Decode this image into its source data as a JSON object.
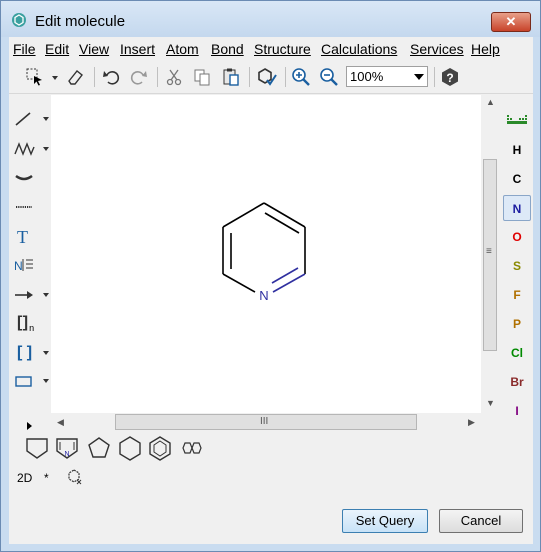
{
  "window": {
    "title": "Edit molecule",
    "close_label": "✕"
  },
  "menu": [
    "File",
    "Edit",
    "View",
    "Insert",
    "Atom",
    "Bond",
    "Structure",
    "Calculations",
    "Services",
    "Help"
  ],
  "toolbar": {
    "zoom_value": "100%"
  },
  "left_tools": {
    "text_tool": "T",
    "bracket_n": "[ ]",
    "bracket_n_sub": "n",
    "bracket": "[ ]"
  },
  "atoms": [
    "H",
    "C",
    "N",
    "O",
    "S",
    "F",
    "P",
    "Cl",
    "Br",
    "I"
  ],
  "atom_colors": [
    "#000000",
    "#000000",
    "#1c1ca0",
    "#e00000",
    "#8a8a00",
    "#b07000",
    "#b07000",
    "#008a00",
    "#8a2a2a",
    "#800080"
  ],
  "selected_atom": "N",
  "molecule": {
    "label": "N",
    "atom_color": "#3030a0"
  },
  "bottom": {
    "label_2d": "2D",
    "label_star": "*"
  },
  "buttons": {
    "set_query": "Set Query",
    "cancel": "Cancel"
  }
}
